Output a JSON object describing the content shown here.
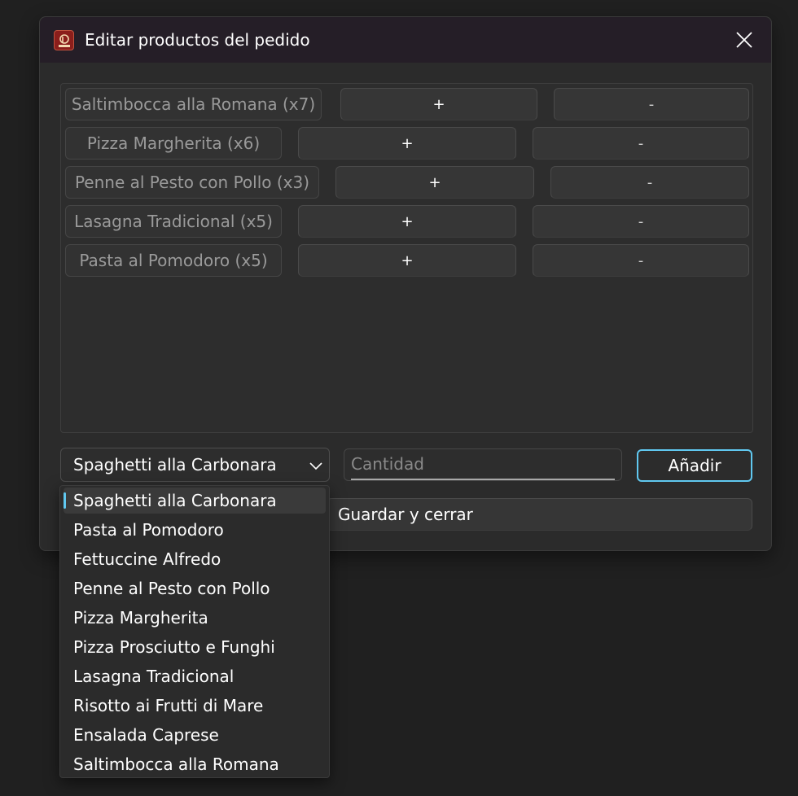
{
  "window": {
    "title": "Editar productos del pedido",
    "app_icon": "trattoria-luna-logo",
    "close_icon": "close-icon"
  },
  "order_items": [
    {
      "label": "Saltimbocca alla Romana (x7)",
      "plus": "+",
      "minus": "-"
    },
    {
      "label": "Pizza Margherita (x6)",
      "plus": "+",
      "minus": "-"
    },
    {
      "label": "Penne al Pesto con Pollo (x3)",
      "plus": "+",
      "minus": "-"
    },
    {
      "label": "Lasagna Tradicional (x5)",
      "plus": "+",
      "minus": "-"
    },
    {
      "label": "Pasta al Pomodoro (x5)",
      "plus": "+",
      "minus": "-"
    }
  ],
  "product_select": {
    "selected": "Spaghetti alla Carbonara",
    "options": [
      "Spaghetti alla Carbonara",
      "Pasta al Pomodoro",
      "Fettuccine Alfredo",
      "Penne al Pesto con Pollo",
      "Pizza Margherita",
      "Pizza Prosciutto e Funghi",
      "Lasagna Tradicional",
      "Risotto ai Frutti di Mare",
      "Ensalada Caprese",
      "Saltimbocca alla Romana"
    ]
  },
  "quantity": {
    "value": "",
    "placeholder": "Cantidad"
  },
  "add_label": "Añadir",
  "save_label": "Guardar y cerrar",
  "colors": {
    "accent": "#60c8f0",
    "background": "#202020",
    "window": "#2b2b2b",
    "titlebar": "#251e27",
    "brand": "#8b1e1b"
  }
}
